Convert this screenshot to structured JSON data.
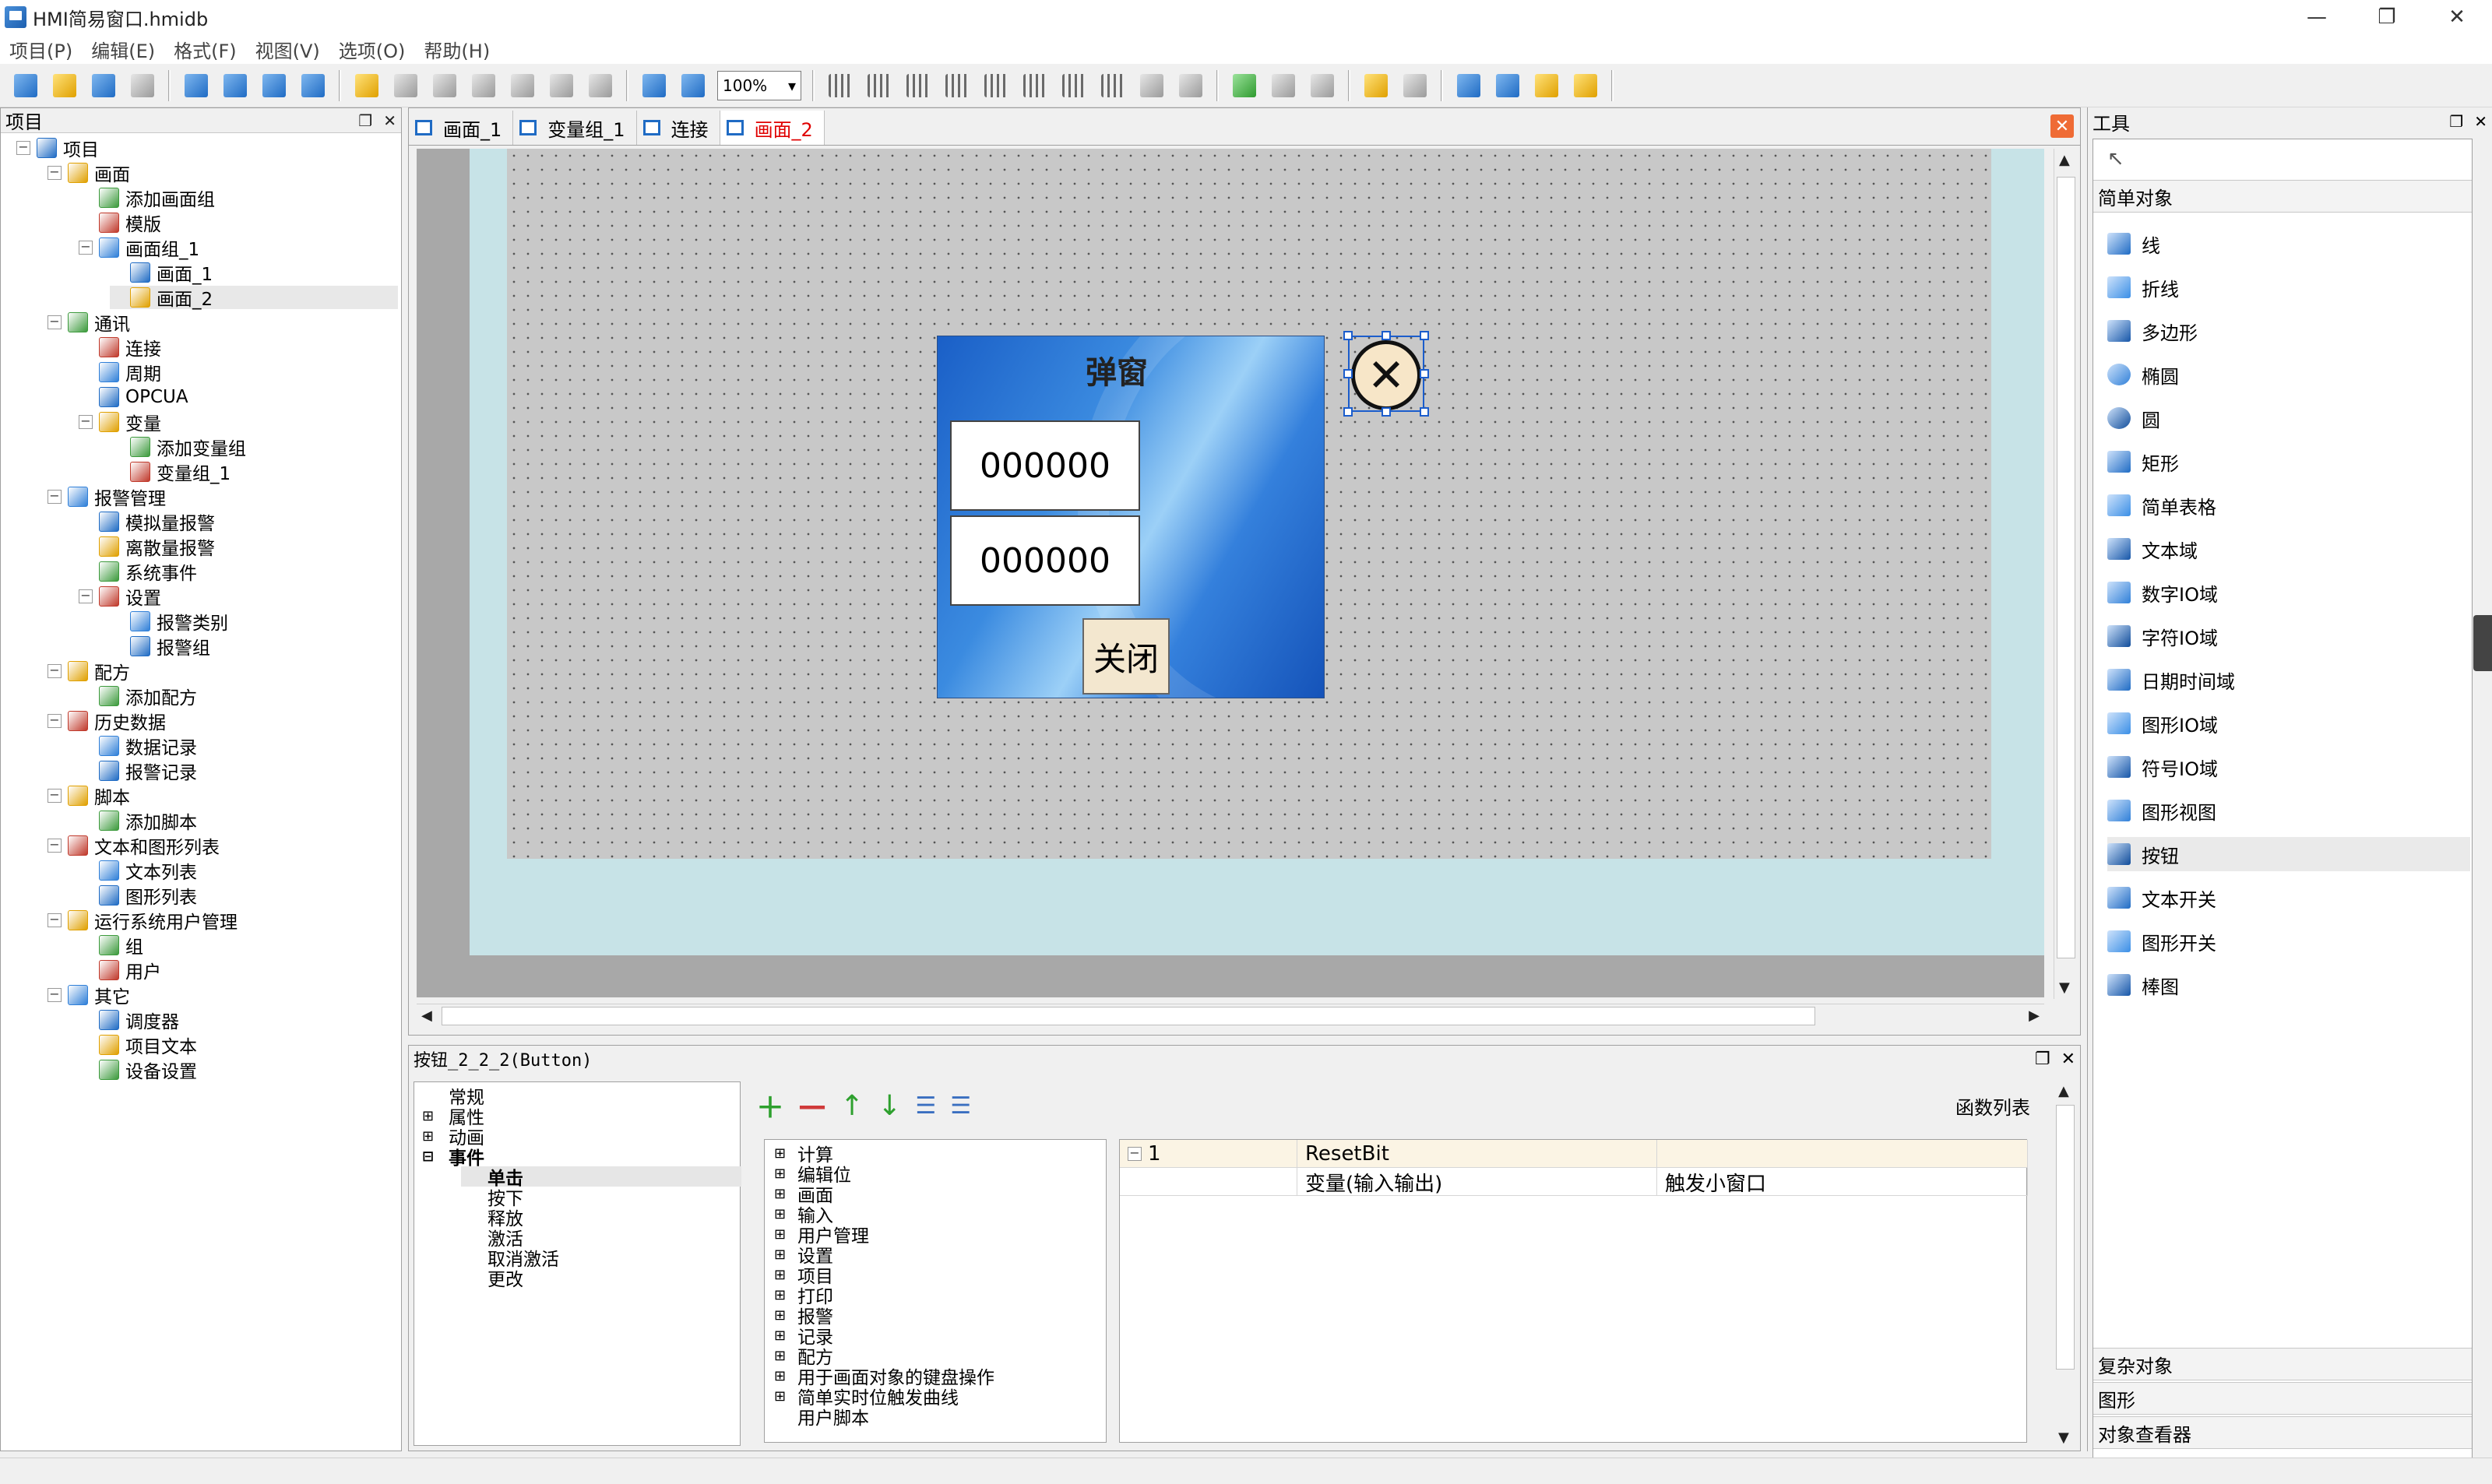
{
  "window": {
    "title": "HMI简易窗口.hmidb",
    "controls": {
      "minimize": "—",
      "maximize": "❐",
      "close": "✕"
    }
  },
  "menu": [
    "项目(P)",
    "编辑(E)",
    "格式(F)",
    "视图(V)",
    "选项(O)",
    "帮助(H)"
  ],
  "toolbar": {
    "zoom": "100%"
  },
  "project_panel": {
    "title": "项目",
    "tree": [
      {
        "label": "项目",
        "level": 0,
        "expander": "-",
        "icon": "project-icon"
      },
      {
        "label": "画面",
        "level": 1,
        "expander": "-",
        "icon": "screens-folder-icon"
      },
      {
        "label": "添加画面组",
        "level": 2,
        "expander": "",
        "icon": "add-screen-group-icon"
      },
      {
        "label": "模版",
        "level": 2,
        "expander": "",
        "icon": "template-icon"
      },
      {
        "label": "画面组_1",
        "level": 2,
        "expander": "-",
        "icon": "screen-group-icon"
      },
      {
        "label": "画面_1",
        "level": 3,
        "expander": "",
        "icon": "screen-icon"
      },
      {
        "label": "画面_2",
        "level": 3,
        "expander": "",
        "icon": "screen-icon",
        "selected": true
      },
      {
        "label": "通讯",
        "level": 1,
        "expander": "-",
        "icon": "communication-folder-icon"
      },
      {
        "label": "连接",
        "level": 2,
        "expander": "",
        "icon": "connection-icon"
      },
      {
        "label": "周期",
        "level": 2,
        "expander": "",
        "icon": "cycle-icon"
      },
      {
        "label": "OPCUA",
        "level": 2,
        "expander": "",
        "icon": "opcua-icon"
      },
      {
        "label": "变量",
        "level": 2,
        "expander": "-",
        "icon": "variables-icon"
      },
      {
        "label": "添加变量组",
        "level": 3,
        "expander": "",
        "icon": "add-variable-group-icon"
      },
      {
        "label": "变量组_1",
        "level": 3,
        "expander": "",
        "icon": "variable-group-icon"
      },
      {
        "label": "报警管理",
        "level": 1,
        "expander": "-",
        "icon": "alarm-management-icon"
      },
      {
        "label": "模拟量报警",
        "level": 2,
        "expander": "",
        "icon": "analog-alarm-icon"
      },
      {
        "label": "离散量报警",
        "level": 2,
        "expander": "",
        "icon": "discrete-alarm-icon"
      },
      {
        "label": "系统事件",
        "level": 2,
        "expander": "",
        "icon": "system-event-icon"
      },
      {
        "label": "设置",
        "level": 2,
        "expander": "-",
        "icon": "settings-icon"
      },
      {
        "label": "报警类别",
        "level": 3,
        "expander": "",
        "icon": "alarm-class-icon"
      },
      {
        "label": "报警组",
        "level": 3,
        "expander": "",
        "icon": "alarm-group-icon"
      },
      {
        "label": "配方",
        "level": 1,
        "expander": "-",
        "icon": "recipe-folder-icon"
      },
      {
        "label": "添加配方",
        "level": 2,
        "expander": "",
        "icon": "add-recipe-icon"
      },
      {
        "label": "历史数据",
        "level": 1,
        "expander": "-",
        "icon": "history-folder-icon"
      },
      {
        "label": "数据记录",
        "level": 2,
        "expander": "",
        "icon": "data-log-icon"
      },
      {
        "label": "报警记录",
        "level": 2,
        "expander": "",
        "icon": "alarm-log-icon"
      },
      {
        "label": "脚本",
        "level": 1,
        "expander": "-",
        "icon": "script-folder-icon"
      },
      {
        "label": "添加脚本",
        "level": 2,
        "expander": "",
        "icon": "add-script-icon"
      },
      {
        "label": "文本和图形列表",
        "level": 1,
        "expander": "-",
        "icon": "lists-folder-icon"
      },
      {
        "label": "文本列表",
        "level": 2,
        "expander": "",
        "icon": "text-list-icon"
      },
      {
        "label": "图形列表",
        "level": 2,
        "expander": "",
        "icon": "graphic-list-icon"
      },
      {
        "label": "运行系统用户管理",
        "level": 1,
        "expander": "-",
        "icon": "user-management-icon"
      },
      {
        "label": "组",
        "level": 2,
        "expander": "",
        "icon": "group-icon"
      },
      {
        "label": "用户",
        "level": 2,
        "expander": "",
        "icon": "user-icon"
      },
      {
        "label": "其它",
        "level": 1,
        "expander": "-",
        "icon": "other-folder-icon"
      },
      {
        "label": "调度器",
        "level": 2,
        "expander": "",
        "icon": "scheduler-icon"
      },
      {
        "label": "项目文本",
        "level": 2,
        "expander": "",
        "icon": "project-text-icon"
      },
      {
        "label": "设备设置",
        "level": 2,
        "expander": "",
        "icon": "device-settings-icon"
      }
    ]
  },
  "editor": {
    "tabs": [
      {
        "label": "画面_1",
        "icon": "screen-icon",
        "active": false
      },
      {
        "label": "变量组_1",
        "icon": "variable-group-icon",
        "active": false
      },
      {
        "label": "连接",
        "icon": "connection-icon",
        "active": false
      },
      {
        "label": "画面_2",
        "icon": "screen-icon",
        "active": true
      }
    ],
    "popup": {
      "title": "弹窗",
      "field1": "000000",
      "field2": "000000",
      "close_label": "关闭",
      "x_glyph": "✕"
    }
  },
  "properties": {
    "title": "按钮_2_2_2(Button)",
    "tree": [
      {
        "label": "常规",
        "expander": "",
        "indent": 0
      },
      {
        "label": "属性",
        "expander": "+",
        "indent": 0
      },
      {
        "label": "动画",
        "expander": "+",
        "indent": 0
      },
      {
        "label": "事件",
        "expander": "-",
        "indent": 0,
        "bold": true
      },
      {
        "label": "单击",
        "expander": "",
        "indent": 1,
        "bold": true,
        "selected": true
      },
      {
        "label": "按下",
        "expander": "",
        "indent": 1
      },
      {
        "label": "释放",
        "expander": "",
        "indent": 1
      },
      {
        "label": "激活",
        "expander": "",
        "indent": 1
      },
      {
        "label": "取消激活",
        "expander": "",
        "indent": 1
      },
      {
        "label": "更改",
        "expander": "",
        "indent": 1
      }
    ],
    "function_list_label": "函数列表",
    "function_tree": [
      "计算",
      "编辑位",
      "画面",
      "输入",
      "用户管理",
      "设置",
      "项目",
      "打印",
      "报警",
      "记录",
      "配方",
      "用于画面对象的键盘操作",
      "简单实时位触发曲线",
      "用户脚本"
    ],
    "function_table": {
      "row1": {
        "index": "1",
        "name": "ResetBit",
        "value": ""
      },
      "row2": {
        "index": "",
        "name": "变量(输入输出)",
        "value": "触发小窗口"
      }
    }
  },
  "tools_panel": {
    "title": "工具",
    "categories": {
      "simple": "简单对象",
      "complex": "复杂对象",
      "graphics": "图形",
      "viewer": "对象查看器"
    },
    "simple_items": [
      {
        "label": "线",
        "icon": "line-icon"
      },
      {
        "label": "折线",
        "icon": "polyline-icon"
      },
      {
        "label": "多边形",
        "icon": "polygon-icon"
      },
      {
        "label": "椭圆",
        "icon": "ellipse-icon"
      },
      {
        "label": "圆",
        "icon": "circle-icon"
      },
      {
        "label": "矩形",
        "icon": "rectangle-icon"
      },
      {
        "label": "简单表格",
        "icon": "simple-table-icon"
      },
      {
        "label": "文本域",
        "icon": "text-field-icon"
      },
      {
        "label": "数字IO域",
        "icon": "numeric-io-icon"
      },
      {
        "label": "字符IO域",
        "icon": "string-io-icon"
      },
      {
        "label": "日期时间域",
        "icon": "datetime-icon"
      },
      {
        "label": "图形IO域",
        "icon": "graphic-io-icon"
      },
      {
        "label": "符号IO域",
        "icon": "symbolic-io-icon"
      },
      {
        "label": "图形视图",
        "icon": "graphic-view-icon"
      },
      {
        "label": "按钮",
        "icon": "button-icon",
        "selected": true
      },
      {
        "label": "文本开关",
        "icon": "text-switch-icon"
      },
      {
        "label": "图形开关",
        "icon": "graphic-switch-icon"
      },
      {
        "label": "棒图",
        "icon": "bar-graph-icon"
      }
    ]
  },
  "colors": {
    "accent_blue": "#1f6bc4",
    "active_tab_text": "#e00000",
    "close_tab_orange": "#ef6b35",
    "screen_bg": "#c7e3e7"
  }
}
